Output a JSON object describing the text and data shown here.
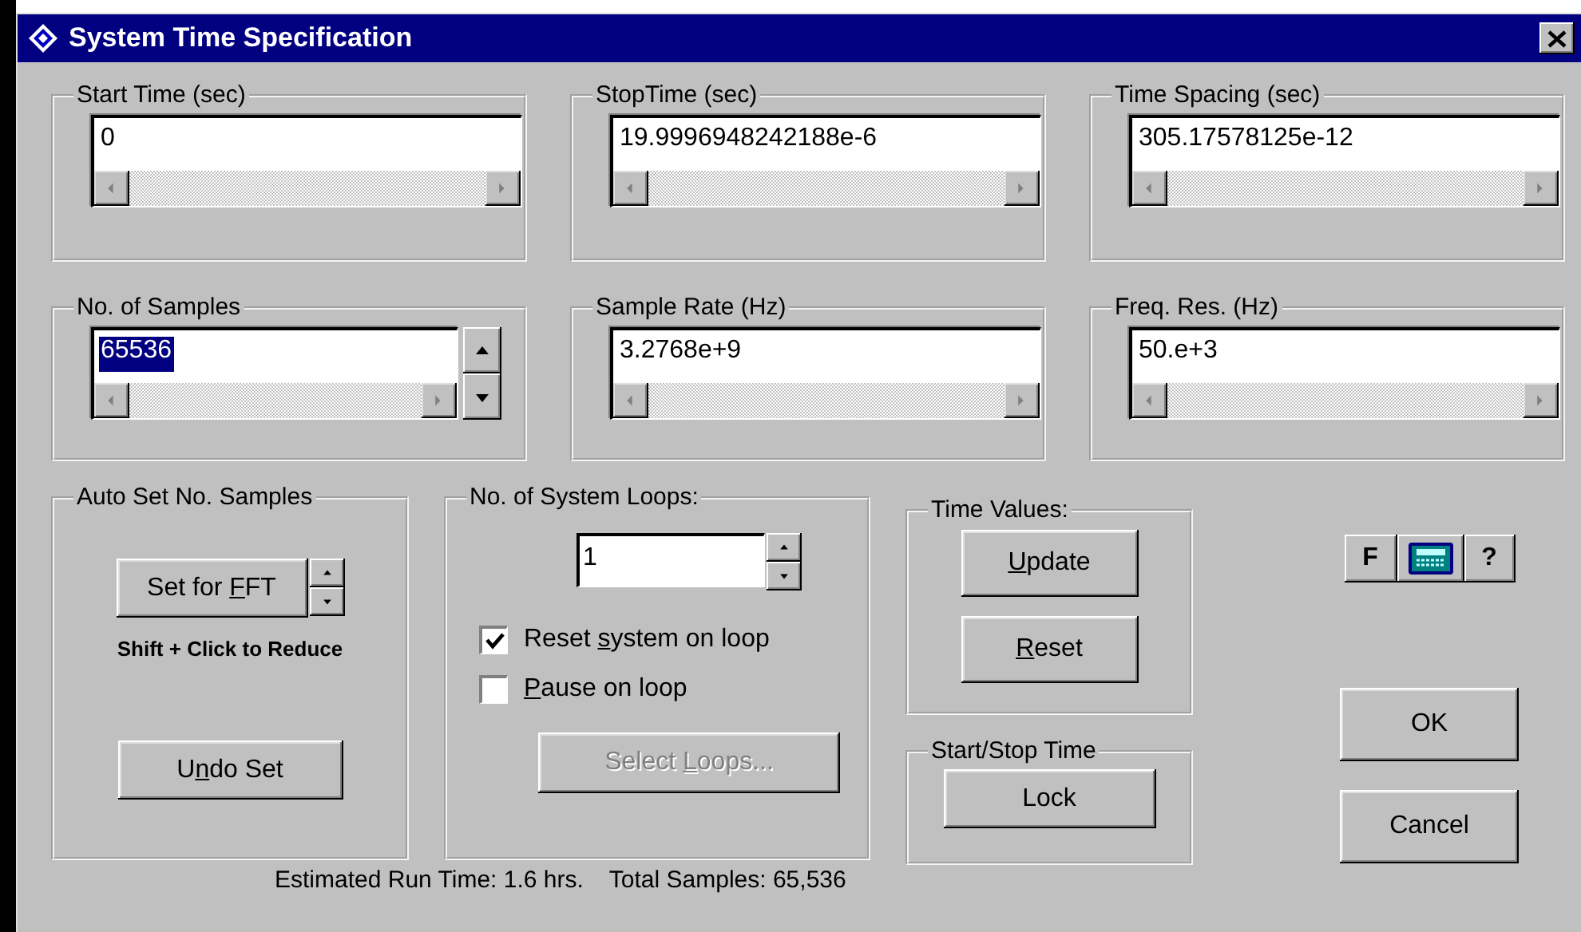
{
  "window": {
    "title": "System Time Specification"
  },
  "fields": [
    {
      "label": "Start Time (sec)",
      "value": "0",
      "kind": "plain",
      "text_selected": false
    },
    {
      "label": "StopTime (sec)",
      "value": "19.9996948242188e-6",
      "kind": "plain",
      "text_selected": false
    },
    {
      "label": "Time Spacing (sec)",
      "value": "305.17578125e-12",
      "kind": "plain",
      "text_selected": false
    },
    {
      "label": "No. of Samples",
      "value": "65536",
      "kind": "spin",
      "text_selected": true
    },
    {
      "label": "Sample Rate (Hz)",
      "value": "3.2768e+9",
      "kind": "plain",
      "text_selected": false
    },
    {
      "label": "Freq. Res. (Hz)",
      "value": "50.e+3",
      "kind": "plain",
      "text_selected": false
    }
  ],
  "auto_set": {
    "title": "Auto Set No. Samples",
    "button": {
      "before": "Set for ",
      "key": "F",
      "after": "FT"
    },
    "hint": "Shift + Click to Reduce",
    "undo": {
      "before": "U",
      "key": "n",
      "after": "do Set"
    }
  },
  "loops": {
    "title": "No. of System Loops:",
    "value": "1",
    "options": [
      {
        "label": {
          "before": "Reset ",
          "key": "s",
          "after": "ystem on loop"
        },
        "checked": true
      },
      {
        "label": {
          "key": "P",
          "after": "ause on loop"
        },
        "checked": false
      }
    ],
    "select_button": {
      "label": {
        "before": "Select ",
        "key": "L",
        "after": "oops..."
      },
      "disabled": true
    }
  },
  "time_values": {
    "title": "Time Values:",
    "buttons": [
      {
        "key": "U",
        "after": "pdate"
      },
      {
        "key": "R",
        "after": "eset"
      }
    ]
  },
  "start_stop": {
    "title": "Start/Stop Time",
    "button": "Lock"
  },
  "tools": [
    {
      "kind": "text",
      "label": "F"
    },
    {
      "kind": "calculator"
    },
    {
      "kind": "text",
      "label": "?"
    }
  ],
  "ok": "OK",
  "cancel": "Cancel",
  "status": [
    "Estimated Run Time: 1.6 hrs.",
    "Total Samples: 65,536"
  ]
}
